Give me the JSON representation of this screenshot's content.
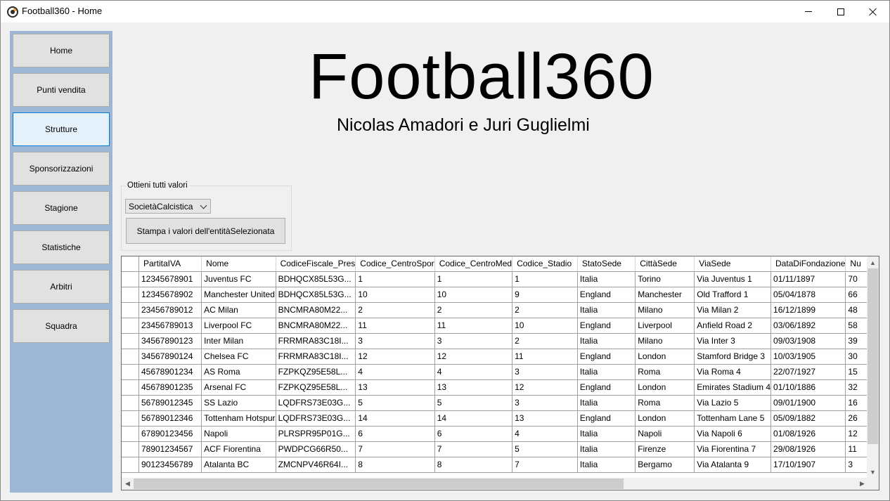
{
  "window": {
    "title": "Football360 - Home"
  },
  "sidebar": {
    "items": [
      {
        "label": "Home"
      },
      {
        "label": "Punti vendita"
      },
      {
        "label": "Strutture"
      },
      {
        "label": "Sponsorizzazioni"
      },
      {
        "label": "Stagione"
      },
      {
        "label": "Statistiche"
      },
      {
        "label": "Arbitri"
      },
      {
        "label": "Squadra"
      }
    ],
    "active": "Strutture"
  },
  "hero": {
    "title": "Football360",
    "subtitle": "Nicolas Amadori e Juri Guglielmi"
  },
  "query_panel": {
    "legend": "Ottieni tutti valori",
    "entity_select": "SocietàCalcistica",
    "print_button": "Stampa i valori dell'entitàSelezionata"
  },
  "table": {
    "columns": [
      "PartitaIVA",
      "Nome",
      "CodiceFiscale_Pres",
      "Codice_CentroSpor",
      "Codice_CentroMed",
      "Codice_Stadio",
      "StatoSede",
      "CittàSede",
      "ViaSede",
      "DataDiFondazione",
      "Nu"
    ],
    "rows": [
      [
        "12345678901",
        "Juventus FC",
        "BDHQCX85L53G...",
        "1",
        "1",
        "1",
        "Italia",
        "Torino",
        "Via Juventus 1",
        "01/11/1897",
        "70"
      ],
      [
        "12345678902",
        "Manchester United",
        "BDHQCX85L53G...",
        "10",
        "10",
        "9",
        "England",
        "Manchester",
        "Old Trafford 1",
        "05/04/1878",
        "66"
      ],
      [
        "23456789012",
        "AC Milan",
        "BNCMRA80M22...",
        "2",
        "2",
        "2",
        "Italia",
        "Milano",
        "Via Milan 2",
        "16/12/1899",
        "48"
      ],
      [
        "23456789013",
        "Liverpool FC",
        "BNCMRA80M22...",
        "11",
        "11",
        "10",
        "England",
        "Liverpool",
        "Anfield Road 2",
        "03/06/1892",
        "58"
      ],
      [
        "34567890123",
        "Inter Milan",
        "FRRMRA83C18I...",
        "3",
        "3",
        "2",
        "Italia",
        "Milano",
        "Via Inter 3",
        "09/03/1908",
        "39"
      ],
      [
        "34567890124",
        "Chelsea FC",
        "FRRMRA83C18I...",
        "12",
        "12",
        "11",
        "England",
        "London",
        "Stamford Bridge 3",
        "10/03/1905",
        "30"
      ],
      [
        "45678901234",
        "AS Roma",
        "FZPKQZ95E58L...",
        "4",
        "4",
        "3",
        "Italia",
        "Roma",
        "Via Roma 4",
        "22/07/1927",
        "15"
      ],
      [
        "45678901235",
        "Arsenal FC",
        "FZPKQZ95E58L...",
        "13",
        "13",
        "12",
        "England",
        "London",
        "Emirates Stadium 4",
        "01/10/1886",
        "32"
      ],
      [
        "56789012345",
        "SS Lazio",
        "LQDFRS73E03G...",
        "5",
        "5",
        "3",
        "Italia",
        "Roma",
        "Via Lazio 5",
        "09/01/1900",
        "16"
      ],
      [
        "56789012346",
        "Tottenham Hotspur",
        "LQDFRS73E03G...",
        "14",
        "14",
        "13",
        "England",
        "London",
        "Tottenham Lane 5",
        "05/09/1882",
        "26"
      ],
      [
        "67890123456",
        "Napoli",
        "PLRSPR95P01G...",
        "6",
        "6",
        "4",
        "Italia",
        "Napoli",
        "Via Napoli 6",
        "01/08/1926",
        "12"
      ],
      [
        "78901234567",
        "ACF Fiorentina",
        "PWDPCG66R50...",
        "7",
        "7",
        "5",
        "Italia",
        "Firenze",
        "Via Fiorentina 7",
        "29/08/1926",
        "11"
      ],
      [
        "90123456789",
        "Atalanta BC",
        "ZMCNPV46R64I...",
        "8",
        "8",
        "7",
        "Italia",
        "Bergamo",
        "Via Atalanta 9",
        "17/10/1907",
        "3"
      ]
    ]
  }
}
